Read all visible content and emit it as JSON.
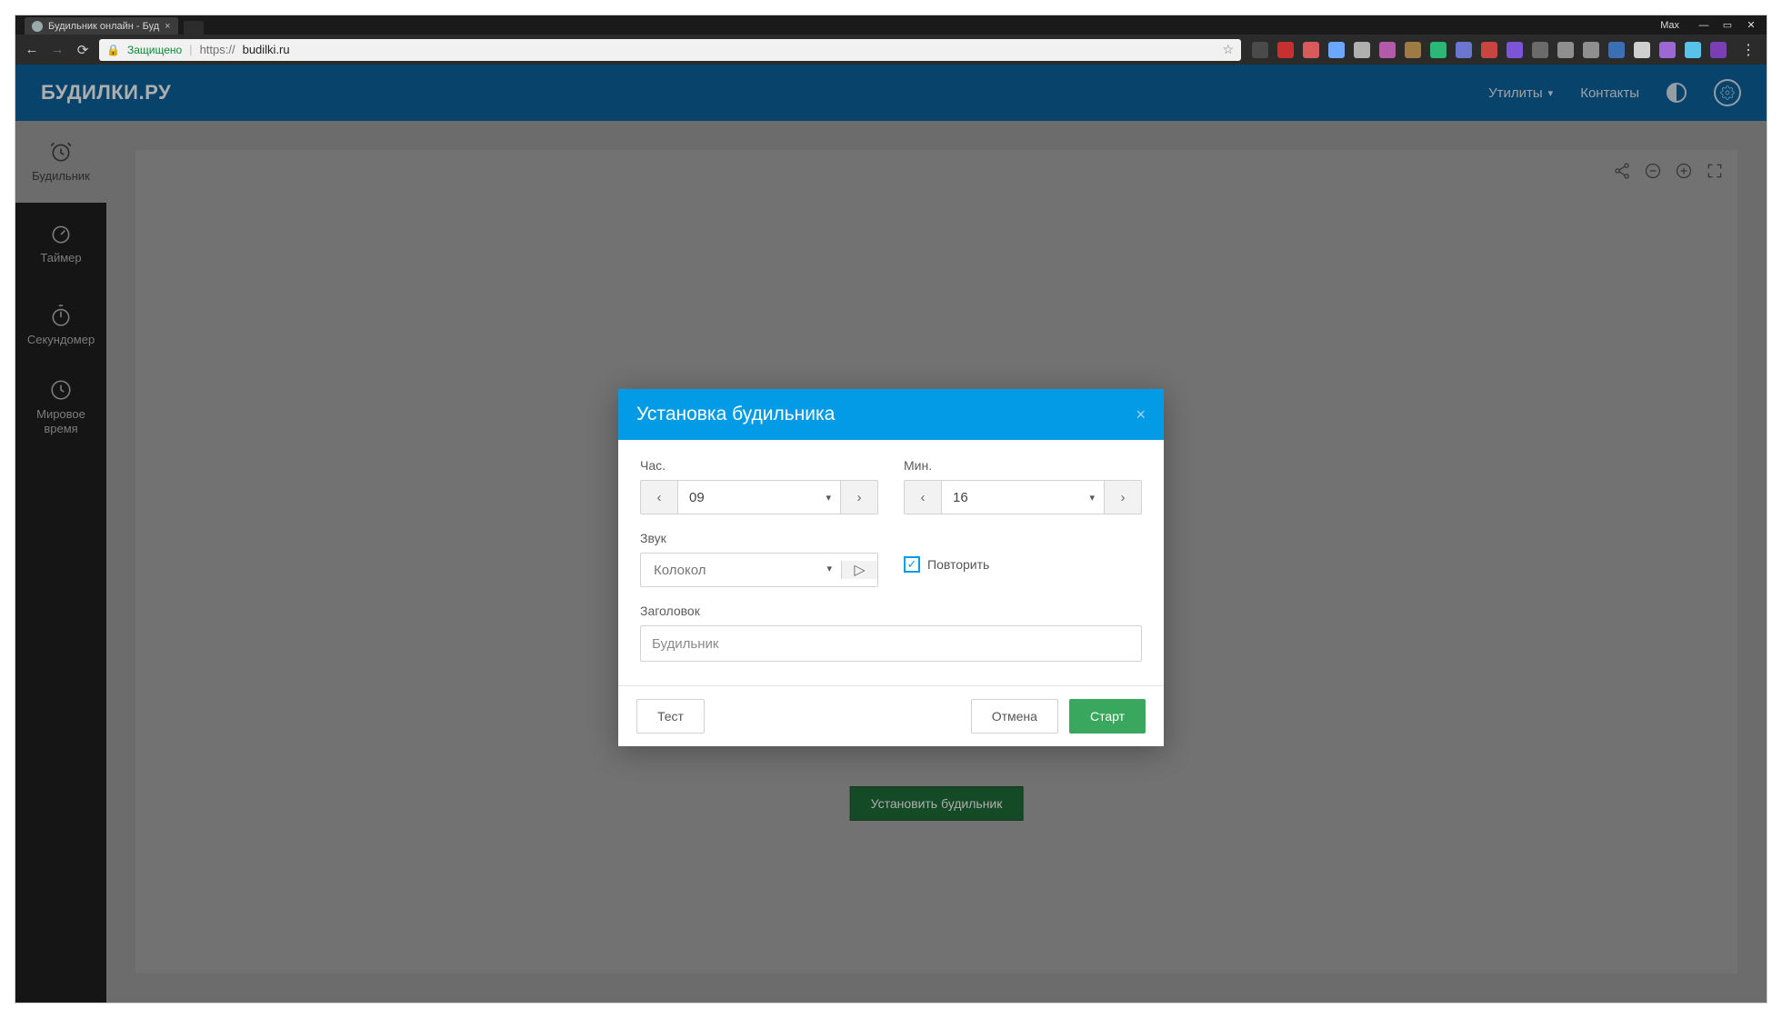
{
  "browser": {
    "tab_title": "Будильник онлайн - Буд",
    "user": "Max",
    "secure_label": "Защищено",
    "url_prefix": "https://",
    "url_host": "budilki.ru"
  },
  "header": {
    "logo": "БУДИЛКИ.РУ",
    "nav_utils": "Утилиты",
    "nav_contacts": "Контакты"
  },
  "sidebar": {
    "items": [
      {
        "label": "Будильник"
      },
      {
        "label": "Таймер"
      },
      {
        "label": "Секундомер"
      },
      {
        "label": "Мировое время"
      }
    ]
  },
  "main": {
    "set_alarm_btn": "Установить будильник"
  },
  "dialog": {
    "title": "Установка будильника",
    "hour_label": "Час.",
    "minute_label": "Мин.",
    "hour_value": "09",
    "minute_value": "16",
    "sound_label": "Звук",
    "sound_value": "Колокол",
    "repeat_label": "Повторить",
    "repeat_checked": true,
    "title_label": "Заголовок",
    "title_placeholder": "Будильник",
    "btn_test": "Тест",
    "btn_cancel": "Отмена",
    "btn_start": "Старт"
  },
  "ext_colors": [
    "#4a4a4a",
    "#c73030",
    "#d85a5a",
    "#6aa8ff",
    "#b0b0b0",
    "#b35aa8",
    "#9e7b44",
    "#2ab876",
    "#6a76d0",
    "#c7463f",
    "#7b55d6",
    "#6b6b6b",
    "#8f8f8f",
    "#8f8f8f",
    "#3a6fb4",
    "#cfcfcf",
    "#9d68d4",
    "#59c2e8",
    "#7a3fb5"
  ]
}
